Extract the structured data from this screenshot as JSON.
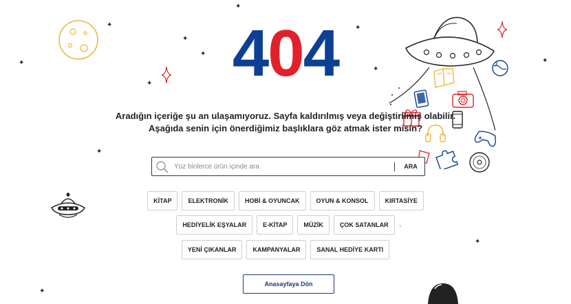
{
  "hero": {
    "code_first": "4",
    "code_middle": "0",
    "code_last": "4",
    "colors": {
      "blue": "#0d3f94",
      "red": "#e2202a"
    }
  },
  "message": {
    "line1": "Aradığın içeriğe şu an ulaşamıyoruz. Sayfa kaldırılmış veya değiştirilmiş olabilir.",
    "line2": "Aşağıda senin için önerdiğimiz başlıklara göz atmak ister misin?"
  },
  "search": {
    "placeholder": "Yüz binlerce ürün içinde ara",
    "value": "",
    "button_label": "ARA",
    "icon": "search-icon"
  },
  "categories": {
    "row1": [
      "KİTAP",
      "ELEKTRONİK",
      "HOBİ & OYUNCAK",
      "OYUN & KONSOL",
      "KIRTASİYE"
    ],
    "row2": [
      "HEDİYELİK EŞYALAR",
      "E-KİTAP",
      "MÜZİK",
      "ÇOK SATANLAR"
    ],
    "row3": [
      "YENİ ÇIKANLAR",
      "KAMPANYALAR",
      "SANAL HEDİYE KARTI"
    ]
  },
  "home_button": {
    "label": "Anasayfaya Dön"
  },
  "decorations": [
    "moon-icon",
    "ufo-icon",
    "small-ufo-icon",
    "book-icon",
    "camera-icon",
    "tablet-icon",
    "gift-icon",
    "phone-icon",
    "headphones-icon",
    "gamepad-icon",
    "puzzle-icon",
    "vinyl-record-icon",
    "planet-icon",
    "sparkle-icon",
    "star-icon"
  ]
}
